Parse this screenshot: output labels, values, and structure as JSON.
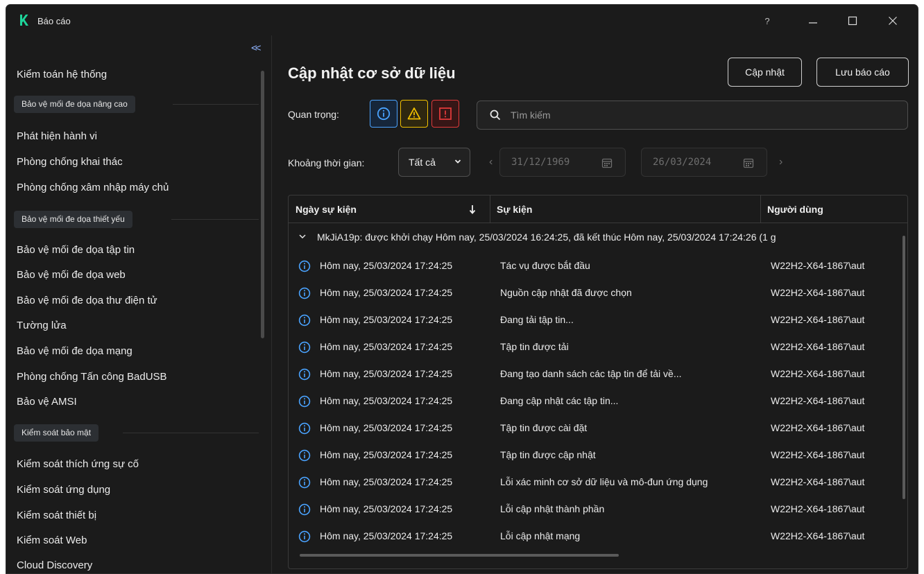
{
  "window": {
    "title": "Báo cáo",
    "help": "?"
  },
  "sidebar": {
    "collapse": "<<",
    "items": [
      {
        "label": "Kiểm toán hệ thống"
      },
      {
        "group": "Bảo vệ mối đe dọa nâng cao"
      },
      {
        "label": "Phát hiện hành vi"
      },
      {
        "label": "Phòng chống khai thác"
      },
      {
        "label": "Phòng chống xâm nhập máy chủ"
      },
      {
        "group": "Bảo vệ mối đe dọa thiết yếu"
      },
      {
        "label": "Bảo vệ mối đe dọa tập tin"
      },
      {
        "label": "Bảo vệ mối đe dọa web"
      },
      {
        "label": "Bảo vệ mối đe dọa thư điện tử"
      },
      {
        "label": "Tường lửa"
      },
      {
        "label": "Bảo vệ mối đe dọa mạng"
      },
      {
        "label": "Phòng chống Tấn công BadUSB"
      },
      {
        "label": "Bảo vệ AMSI"
      },
      {
        "group": "Kiểm soát bảo mật"
      },
      {
        "label": "Kiểm soát thích ứng sự cố"
      },
      {
        "label": "Kiểm soát ứng dụng"
      },
      {
        "label": "Kiểm soát thiết bị"
      },
      {
        "label": "Kiểm soát Web"
      },
      {
        "label": "Cloud Discovery"
      }
    ]
  },
  "main": {
    "title": "Cập nhật cơ sở dữ liệu",
    "update_button": "Cập nhật",
    "save_button": "Lưu báo cáo",
    "importance_label": "Quan trọng:",
    "search_placeholder": "Tìm kiếm",
    "period_label": "Khoảng thời gian:",
    "period_value": "Tất cả",
    "date_from": "31/12/1969",
    "date_to": "26/03/2024",
    "colors": {
      "info": "#4aa3ff",
      "warning": "#f2c100",
      "critical": "#e03a3a"
    }
  },
  "table": {
    "headers": {
      "date": "Ngày sự kiện",
      "event": "Sự kiện",
      "user": "Người dùng"
    },
    "group": "MkJiA19p: được khởi chạy Hôm nay, 25/03/2024 16:24:25, đã kết thúc Hôm nay, 25/03/2024 17:24:26 (1 g",
    "rows": [
      {
        "date": "Hôm nay, 25/03/2024 17:24:25",
        "event": "Tác vụ được bắt đầu",
        "user": "W22H2-X64-1867\\aut"
      },
      {
        "date": "Hôm nay, 25/03/2024 17:24:25",
        "event": "Nguồn cập nhật đã được chọn",
        "user": "W22H2-X64-1867\\aut"
      },
      {
        "date": "Hôm nay, 25/03/2024 17:24:25",
        "event": "Đang tải tập tin...",
        "user": "W22H2-X64-1867\\aut"
      },
      {
        "date": "Hôm nay, 25/03/2024 17:24:25",
        "event": "Tập tin được tải",
        "user": "W22H2-X64-1867\\aut"
      },
      {
        "date": "Hôm nay, 25/03/2024 17:24:25",
        "event": "Đang tạo danh sách các tập tin để tải về...",
        "user": "W22H2-X64-1867\\aut"
      },
      {
        "date": "Hôm nay, 25/03/2024 17:24:25",
        "event": "Đang cập nhật các tập tin...",
        "user": "W22H2-X64-1867\\aut"
      },
      {
        "date": "Hôm nay, 25/03/2024 17:24:25",
        "event": "Tập tin được cài đặt",
        "user": "W22H2-X64-1867\\aut"
      },
      {
        "date": "Hôm nay, 25/03/2024 17:24:25",
        "event": "Tập tin được cập nhật",
        "user": "W22H2-X64-1867\\aut"
      },
      {
        "date": "Hôm nay, 25/03/2024 17:24:25",
        "event": "Lỗi xác minh cơ sở dữ liệu và mô-đun ứng dụng",
        "user": "W22H2-X64-1867\\aut"
      },
      {
        "date": "Hôm nay, 25/03/2024 17:24:25",
        "event": "Lỗi cập nhật thành phần",
        "user": "W22H2-X64-1867\\aut"
      },
      {
        "date": "Hôm nay, 25/03/2024 17:24:25",
        "event": "Lỗi cập nhật mạng",
        "user": "W22H2-X64-1867\\aut"
      }
    ]
  }
}
